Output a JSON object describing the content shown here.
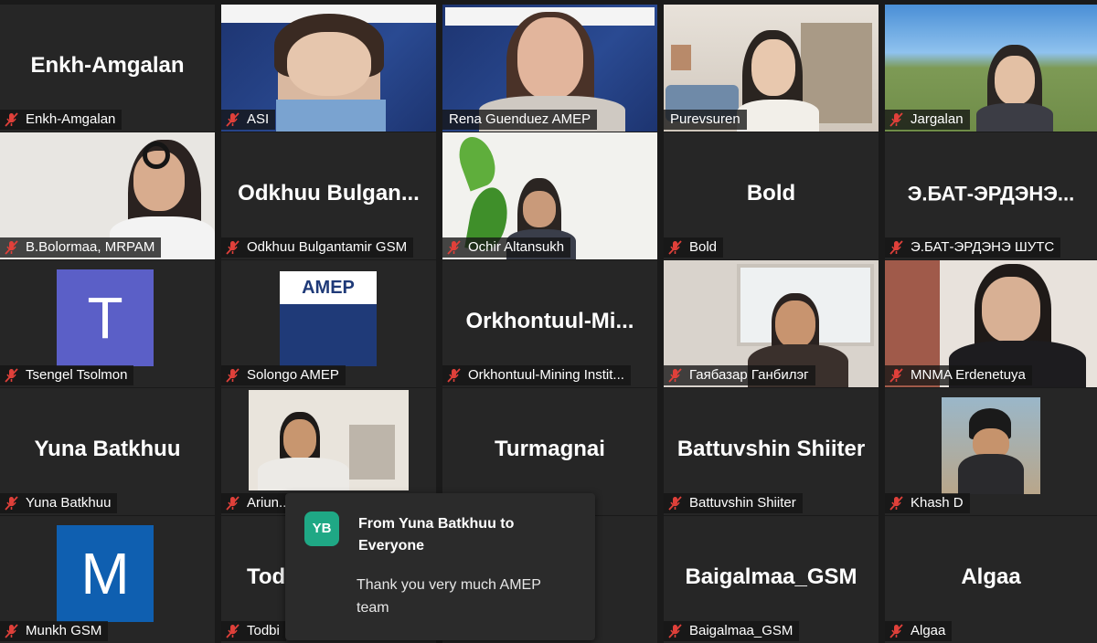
{
  "tiles": [
    {
      "name": "Enkh-Amgalan",
      "big": "Enkh-Amgalan",
      "type": "name"
    },
    {
      "name": "ASI",
      "type": "video",
      "variant": "asi"
    },
    {
      "name": "Rena Guenduez AMEP",
      "type": "video",
      "variant": "rena",
      "active": true
    },
    {
      "name": "Purevsuren",
      "type": "video",
      "variant": "purev"
    },
    {
      "name": "Jargalan",
      "type": "video",
      "variant": "jargalan"
    },
    {
      "name": "B.Bolormaa, MRPAM",
      "type": "video",
      "variant": "bolormaa"
    },
    {
      "name": "Odkhuu Bulgantamir GSM",
      "big": "Odkhuu  Bulgan...",
      "type": "name"
    },
    {
      "name": "Ochir Altansukh",
      "type": "video",
      "variant": "ochir"
    },
    {
      "name": "Bold",
      "big": "Bold",
      "type": "name"
    },
    {
      "name": "Э.БАТ-ЭРДЭНЭ ШУТС",
      "big": "Э.БАТ-ЭРДЭНЭ...",
      "type": "name"
    },
    {
      "name": "Tsengel Tsolmon",
      "type": "avatar",
      "letter": "T",
      "color": "#5b5fc7"
    },
    {
      "name": "Solongo AMEP",
      "type": "logo"
    },
    {
      "name": "Orkhontuul-Mining Instit...",
      "big": "Orkhontuul-Mi...",
      "type": "name"
    },
    {
      "name": "Гаябазар Ганбилэг",
      "type": "video",
      "variant": "gaya"
    },
    {
      "name": "MNMA Erdenetuya",
      "type": "video",
      "variant": "erdenetuya"
    },
    {
      "name": "Yuna Batkhuu",
      "big": "Yuna Batkhuu",
      "type": "name"
    },
    {
      "name": "Ariun...",
      "type": "video",
      "variant": "ariun"
    },
    {
      "name": "",
      "big": "Turmagnai",
      "type": "name"
    },
    {
      "name": "Battuvshin Shiiter",
      "big": "Battuvshin Shiiter",
      "type": "name"
    },
    {
      "name": "Khash D",
      "type": "video",
      "variant": "khash"
    },
    {
      "name": "Munkh GSM",
      "type": "avatar",
      "letter": "M",
      "color": "#0f5fb0"
    },
    {
      "name": "Todbi",
      "big": "Tod",
      "type": "name"
    },
    {
      "name": "",
      "big": "",
      "type": "name"
    },
    {
      "name": "Baigalmaa_GSM",
      "big": "Baigalmaa_GSM",
      "type": "name"
    },
    {
      "name": "Algaa",
      "big": "Algaa",
      "type": "name"
    }
  ],
  "chat": {
    "initials": "YB",
    "from": "From Yuna Batkhuu to Everyone",
    "message": "Thank you very much AMEP team"
  },
  "colors": {
    "active_border": "#b8e34b",
    "mute": "#e0403a",
    "chat_avatar": "#1fa885"
  }
}
